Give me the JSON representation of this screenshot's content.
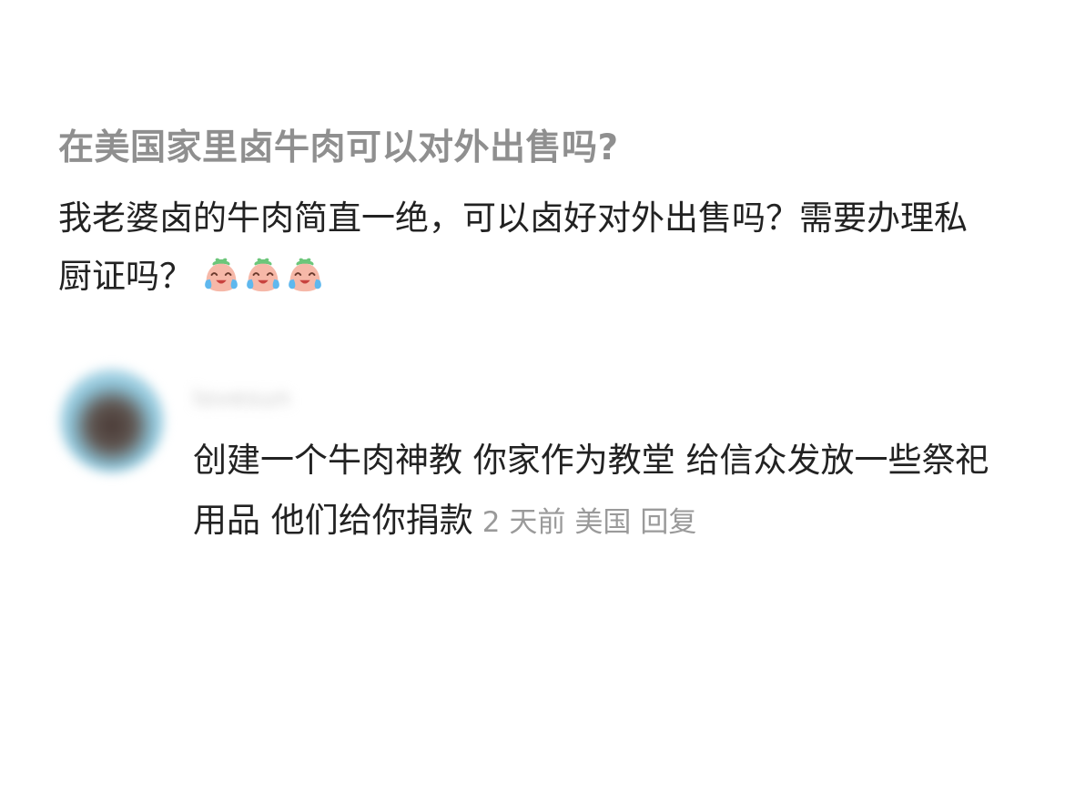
{
  "post": {
    "title": "在美国家里卤牛肉可以对外出售吗?",
    "body": "我老婆卤的牛肉简直一绝，可以卤好对外出售吗？需要办理私厨证吗？",
    "emojis": [
      "crying-laughing-face",
      "crying-laughing-face",
      "crying-laughing-face"
    ]
  },
  "comment": {
    "username": "lovesun",
    "text": "创建一个牛肉神教 你家作为教堂 给信众发放一些祭祀用品 他们给你捐款",
    "time": "2 天前",
    "location": "美国",
    "reply_label": "回复"
  },
  "colors": {
    "title": "#8f8f8f",
    "body": "#222222",
    "meta": "#9a9a9a",
    "background": "#ffffff"
  }
}
